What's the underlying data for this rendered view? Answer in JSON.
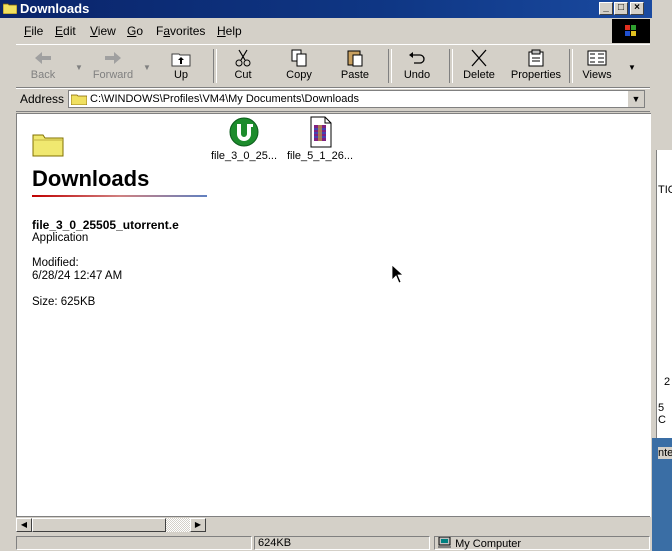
{
  "window": {
    "title": "Downloads"
  },
  "menu": [
    {
      "label": "File",
      "key": "F"
    },
    {
      "label": "Edit",
      "key": "E"
    },
    {
      "label": "View",
      "key": "V"
    },
    {
      "label": "Go",
      "key": "G"
    },
    {
      "label": "Favorites",
      "key": "a"
    },
    {
      "label": "Help",
      "key": "H"
    }
  ],
  "toolbar": {
    "back": "Back",
    "forward": "Forward",
    "up": "Up",
    "cut": "Cut",
    "copy": "Copy",
    "paste": "Paste",
    "undo": "Undo",
    "delete": "Delete",
    "properties": "Properties",
    "views": "Views"
  },
  "address": {
    "label": "Address",
    "path": "C:\\WINDOWS\\Profiles\\VM4\\My Documents\\Downloads"
  },
  "webview": {
    "folder_title": "Downloads",
    "selected_file": "file_3_0_25505_utorrent.e",
    "file_type": "Application",
    "modified_label": "Modified:",
    "modified_value": "6/28/24 12:47 AM",
    "size": "Size: 625KB"
  },
  "files": [
    {
      "name": "file_3_0_25...",
      "icon": "utorrent-icon"
    },
    {
      "name": "file_5_1_26...",
      "icon": "winrar-icon"
    }
  ],
  "status": {
    "size": "624KB",
    "zone": "My Computer"
  },
  "background_fragments": [
    "TIO",
    "2",
    "5 C",
    "nte"
  ]
}
